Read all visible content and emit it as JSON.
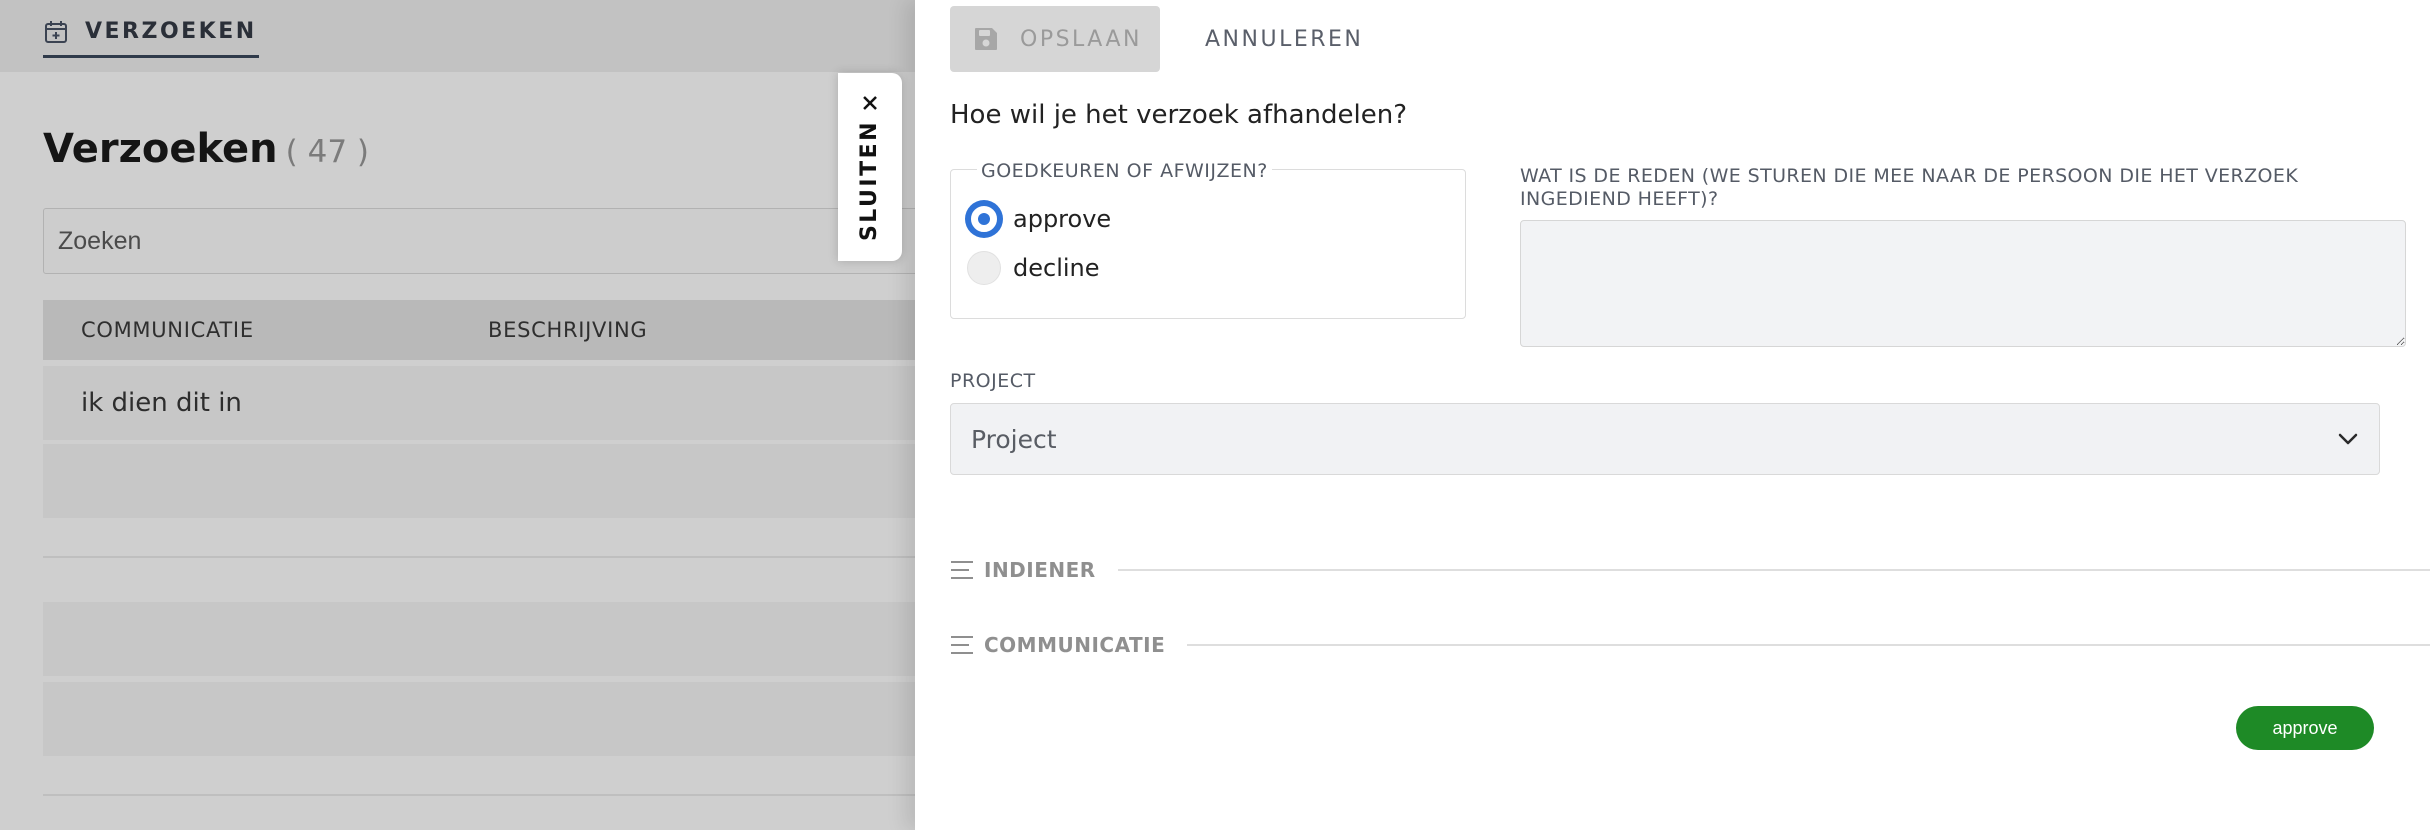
{
  "underlay": {
    "nav_tab_label": "VERZOEKEN",
    "page_title": "Verzoeken",
    "page_count": "( 47 )",
    "search_placeholder": "Zoeken",
    "columns": [
      "COMMUNICATIE",
      "BESCHRIJVING"
    ],
    "rows": [
      {
        "communicatie": "ik dien dit in",
        "beschrijving": ""
      }
    ]
  },
  "close_tab": {
    "label": "SLUITEN",
    "icon": "close-icon"
  },
  "panel": {
    "toolbar": {
      "save_label": "OPSLAAN",
      "cancel_label": "ANNULEREN"
    },
    "question": "Hoe wil je het verzoek afhandelen?",
    "decision": {
      "legend": "GOEDKEUREN OF AFWIJZEN?",
      "options": [
        "approve",
        "decline"
      ],
      "selected": "approve"
    },
    "reason": {
      "label": "WAT IS DE REDEN (WE STUREN DIE MEE NAAR DE PERSOON DIE HET VERZOEK INGEDIEND HEEFT)?",
      "value": ""
    },
    "project": {
      "label": "PROJECT",
      "placeholder": "Project"
    },
    "sections": [
      "INDIENER",
      "COMMUNICATIE"
    ],
    "status_badge": "approve"
  },
  "colors": {
    "accent_blue": "#2f73d7",
    "badge_green": "#1e8a26",
    "overlay_gray": "#cfcfcf"
  }
}
